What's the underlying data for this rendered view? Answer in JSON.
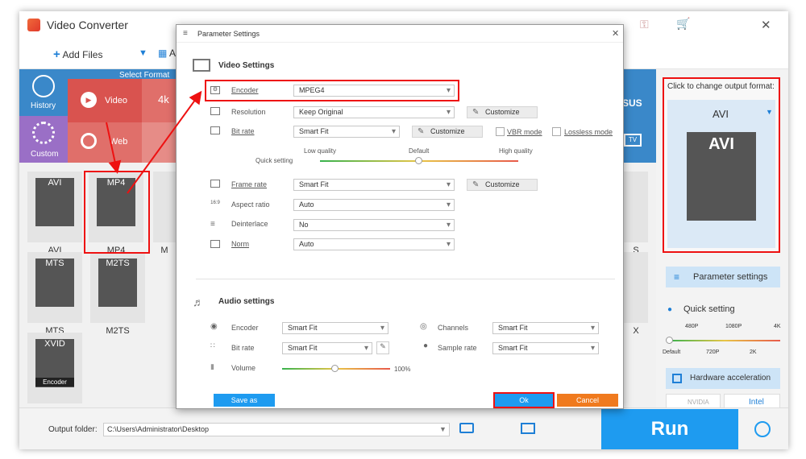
{
  "app": {
    "title": "Video Converter"
  },
  "toolbar": {
    "add_files": "Add Files",
    "add_short": "A"
  },
  "categories": {
    "select_format": "Select Format",
    "history": "History",
    "custom": "Custom",
    "video": "Video",
    "web": "Web",
    "k4": "4k",
    "asus": "SUS",
    "tv": "TV"
  },
  "formats": {
    "avi": "AVI",
    "mp4": "MP4",
    "m": "M",
    "mts": "MTS",
    "m2ts": "M2TS",
    "xvid": "XVID",
    "encoder_badge": "Encoder",
    "x": "X",
    "s": "S"
  },
  "right_panel": {
    "click_change": "Click to change output format:",
    "format": "AVI",
    "param_settings": "Parameter settings",
    "quick_setting": "Quick setting",
    "q_top": [
      "480P",
      "1080P",
      "4K"
    ],
    "q_bottom": [
      "Default",
      "720P",
      "2K"
    ],
    "hw_accel": "Hardware acceleration",
    "nvidia": "NVIDIA",
    "intel": "Intel"
  },
  "bottom": {
    "output_folder_label": "Output folder:",
    "output_folder_value": "C:\\Users\\Administrator\\Desktop",
    "run": "Run"
  },
  "dialog": {
    "title": "Parameter Settings",
    "video_settings": "Video Settings",
    "encoder_label": "Encoder",
    "encoder_value": "MPEG4",
    "resolution_label": "Resolution",
    "resolution_value": "Keep Original",
    "customize": "Customize",
    "bitrate_label": "Bit rate",
    "bitrate_value": "Smart Fit",
    "vbr_mode": "VBR mode",
    "lossless_mode": "Lossless mode",
    "quick_setting": "Quick setting",
    "low_quality": "Low quality",
    "default": "Default",
    "high_quality": "High quality",
    "quality_level": 0.5,
    "framerate_label": "Frame rate",
    "framerate_value": "Smart Fit",
    "aspect_label": "Aspect ratio",
    "aspect_value": "Auto",
    "deinterlace_label": "Deinterlace",
    "deinterlace_value": "No",
    "norm_label": "Norm",
    "norm_value": "Auto",
    "audio_settings": "Audio settings",
    "a_encoder_label": "Encoder",
    "a_encoder_value": "Smart Fit",
    "a_bitrate_label": "Bit rate",
    "a_bitrate_value": "Smart Fit",
    "channels_label": "Channels",
    "channels_value": "Smart Fit",
    "samplerate_label": "Sample rate",
    "samplerate_value": "Smart Fit",
    "volume_label": "Volume",
    "volume_value": "100%",
    "save_as": "Save as",
    "ok": "Ok",
    "cancel": "Cancel"
  },
  "colors": {
    "accent": "#1e9bf0",
    "highlight": "#e11111",
    "cancel": "#f07a1e",
    "category_bg": "#3a88c9",
    "video_tile": "#d9534f"
  }
}
